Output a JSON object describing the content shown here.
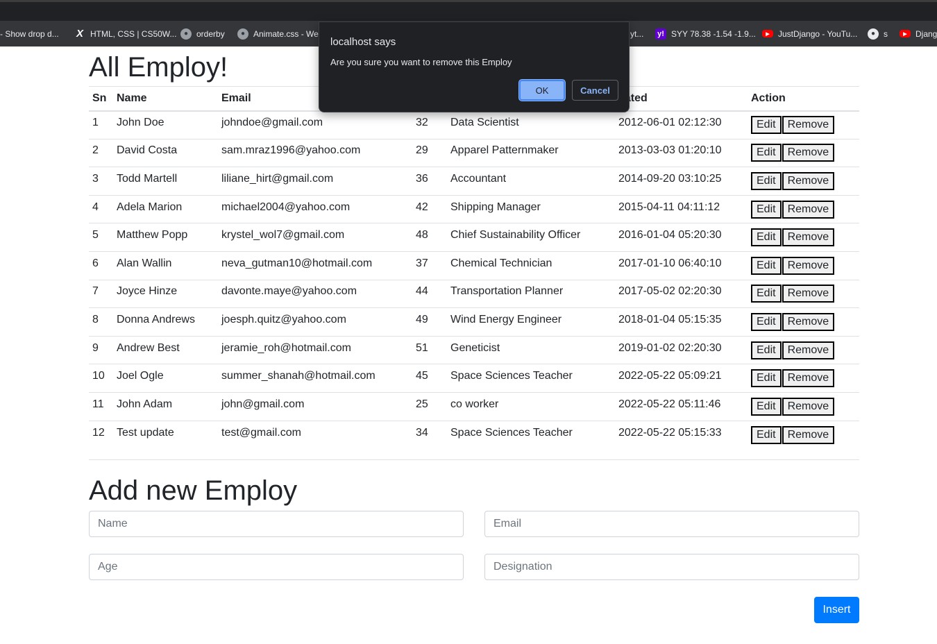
{
  "bookmarks": [
    {
      "label": "- Show drop d...",
      "icon": "none"
    },
    {
      "label": "HTML, CSS | CS50W...",
      "icon": "x-icon"
    },
    {
      "label": "orderby",
      "icon": "globe-icon"
    },
    {
      "label": "Animate.css - Wel",
      "icon": "globe-icon"
    },
    {
      "label": "yt...",
      "icon": "none"
    },
    {
      "label": "SYY 78.38 -1.54 -1.9...",
      "icon": "yahoo-icon"
    },
    {
      "label": "JustDjango - YouTu...",
      "icon": "youtube-icon"
    },
    {
      "label": "s",
      "icon": "github-icon"
    },
    {
      "label": "Djang",
      "icon": "youtube-icon"
    }
  ],
  "page": {
    "title": "All Employ!",
    "add_title": "Add new Employ"
  },
  "table": {
    "headers": [
      "Sn",
      "Name",
      "Email",
      "",
      "",
      "eated",
      "Action"
    ],
    "edit_label": "Edit",
    "remove_label": "Remove",
    "rows": [
      {
        "sn": "1",
        "name": "John Doe",
        "email": "johndoe@gmail.com",
        "age": "32",
        "designation": "Data Scientist",
        "created": "2012-06-01 02:12:30"
      },
      {
        "sn": "2",
        "name": "David Costa",
        "email": "sam.mraz1996@yahoo.com",
        "age": "29",
        "designation": "Apparel Patternmaker",
        "created": "2013-03-03 01:20:10"
      },
      {
        "sn": "3",
        "name": "Todd Martell",
        "email": "liliane_hirt@gmail.com",
        "age": "36",
        "designation": "Accountant",
        "created": "2014-09-20 03:10:25"
      },
      {
        "sn": "4",
        "name": "Adela Marion",
        "email": "michael2004@yahoo.com",
        "age": "42",
        "designation": "Shipping Manager",
        "created": "2015-04-11 04:11:12"
      },
      {
        "sn": "5",
        "name": "Matthew Popp",
        "email": "krystel_wol7@gmail.com",
        "age": "48",
        "designation": "Chief Sustainability Officer",
        "created": "2016-01-04 05:20:30"
      },
      {
        "sn": "6",
        "name": "Alan Wallin",
        "email": "neva_gutman10@hotmail.com",
        "age": "37",
        "designation": "Chemical Technician",
        "created": "2017-01-10 06:40:10"
      },
      {
        "sn": "7",
        "name": "Joyce Hinze",
        "email": "davonte.maye@yahoo.com",
        "age": "44",
        "designation": "Transportation Planner",
        "created": "2017-05-02 02:20:30"
      },
      {
        "sn": "8",
        "name": "Donna Andrews",
        "email": "joesph.quitz@yahoo.com",
        "age": "49",
        "designation": "Wind Energy Engineer",
        "created": "2018-01-04 05:15:35"
      },
      {
        "sn": "9",
        "name": "Andrew Best",
        "email": "jeramie_roh@hotmail.com",
        "age": "51",
        "designation": "Geneticist",
        "created": "2019-01-02 02:20:30"
      },
      {
        "sn": "10",
        "name": "Joel Ogle",
        "email": "summer_shanah@hotmail.com",
        "age": "45",
        "designation": "Space Sciences Teacher",
        "created": "2022-05-22 05:09:21"
      },
      {
        "sn": "11",
        "name": "John Adam",
        "email": "john@gmail.com",
        "age": "25",
        "designation": "co worker",
        "created": "2022-05-22 05:11:46"
      },
      {
        "sn": "12",
        "name": "Test update",
        "email": "test@gmail.com",
        "age": "34",
        "designation": "Space Sciences Teacher",
        "created": "2022-05-22 05:15:33"
      }
    ]
  },
  "form": {
    "name_placeholder": "Name",
    "email_placeholder": "Email",
    "age_placeholder": "Age",
    "designation_placeholder": "Designation",
    "insert_label": "Insert"
  },
  "dialog": {
    "title": "localhost says",
    "message": "Are you sure you want to remove this Employ",
    "ok_label": "OK",
    "cancel_label": "Cancel"
  },
  "colors": {
    "primary": "#007bff",
    "dialog_bg": "#202124",
    "dialog_accent": "#8ab4f8"
  }
}
